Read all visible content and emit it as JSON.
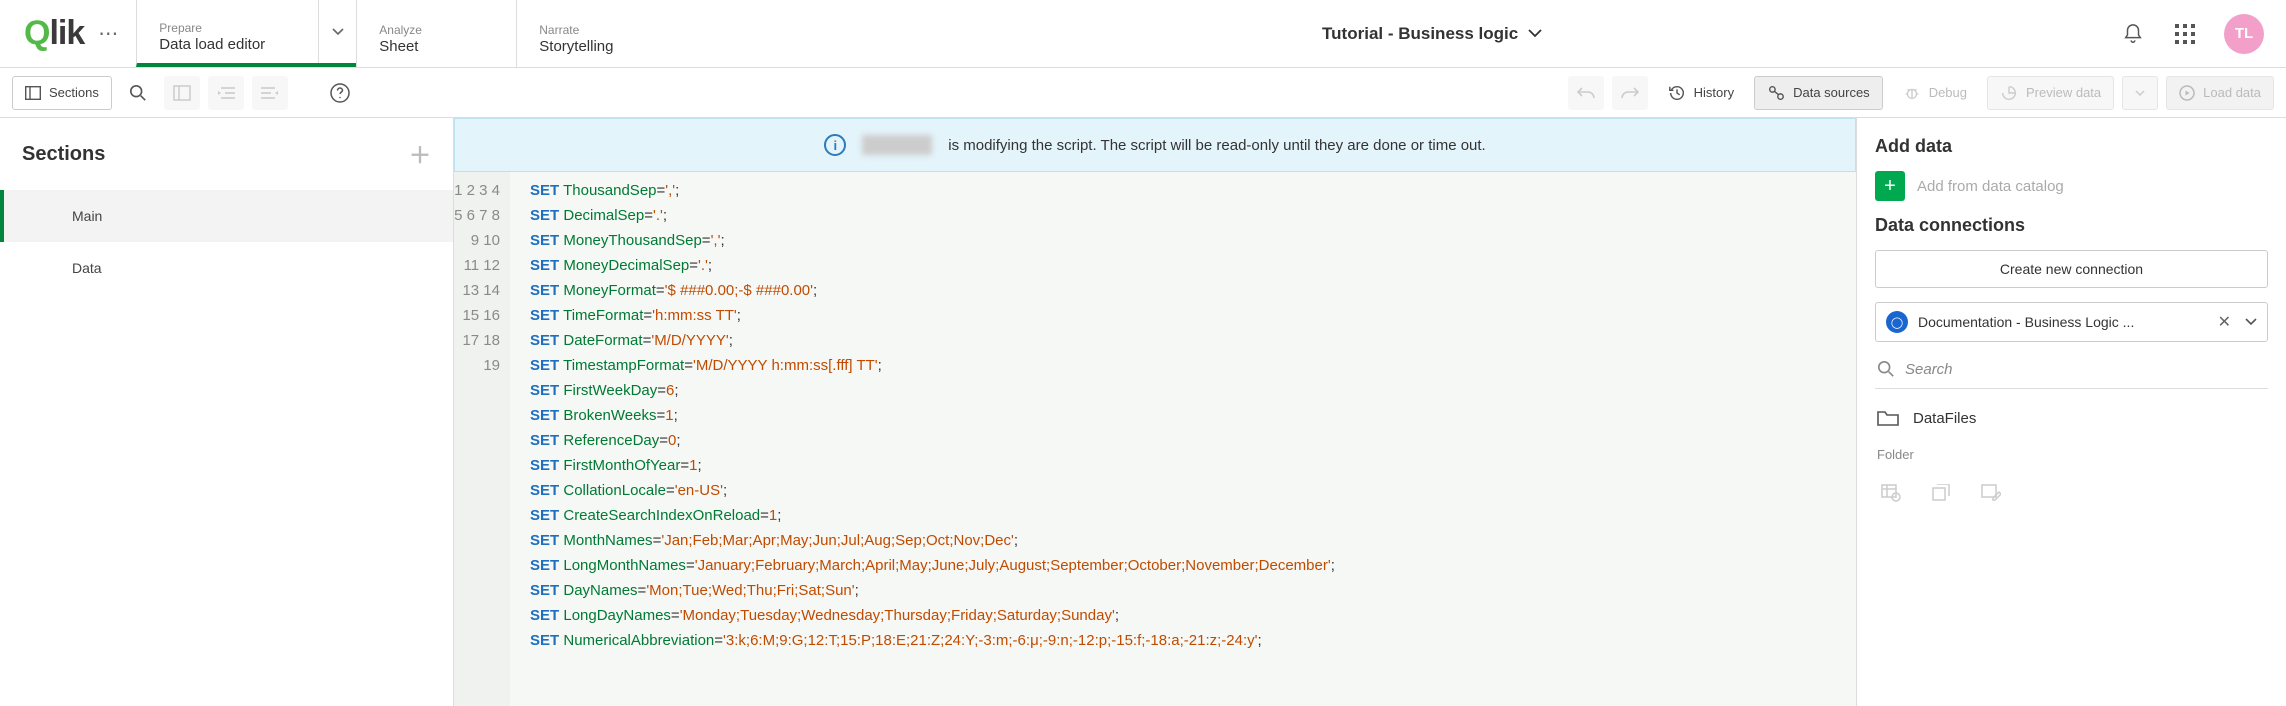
{
  "header": {
    "logo_text": "Qlik",
    "tabs": [
      {
        "small": "Prepare",
        "big": "Data load editor",
        "active": true,
        "has_chevron": true
      },
      {
        "small": "Analyze",
        "big": "Sheet",
        "active": false,
        "has_chevron": false
      },
      {
        "small": "Narrate",
        "big": "Storytelling",
        "active": false,
        "has_chevron": false
      }
    ],
    "app_title": "Tutorial - Business logic",
    "avatar_initials": "TL"
  },
  "toolbar": {
    "sections_label": "Sections",
    "history_label": "History",
    "data_sources_label": "Data sources",
    "debug_label": "Debug",
    "preview_label": "Preview data",
    "load_label": "Load data"
  },
  "sections_panel": {
    "title": "Sections",
    "items": [
      {
        "label": "Main",
        "active": true
      },
      {
        "label": "Data",
        "active": false
      }
    ]
  },
  "banner": {
    "message": "is modifying the script. The script will be read-only until they are done or time out."
  },
  "code": {
    "lines": [
      {
        "n": 1,
        "id": "ThousandSep",
        "rest": "=','",
        "tail": ";"
      },
      {
        "n": 2,
        "id": "DecimalSep",
        "rest": "='.'",
        "tail": ";"
      },
      {
        "n": 3,
        "id": "MoneyThousandSep",
        "rest": "=','",
        "tail": ";"
      },
      {
        "n": 4,
        "id": "MoneyDecimalSep",
        "rest": "='.'",
        "tail": ";"
      },
      {
        "n": 5,
        "id": "MoneyFormat",
        "rest": "='$ ###0.00;-$ ###0.00'",
        "tail": ";"
      },
      {
        "n": 6,
        "id": "TimeFormat",
        "rest": "='h:mm:ss TT'",
        "tail": ";"
      },
      {
        "n": 7,
        "id": "DateFormat",
        "rest": "='M/D/YYYY'",
        "tail": ";"
      },
      {
        "n": 8,
        "id": "TimestampFormat",
        "rest": "='M/D/YYYY h:mm:ss[.fff] TT'",
        "tail": ";"
      },
      {
        "n": 9,
        "id": "FirstWeekDay",
        "rest": "=6",
        "tail": ";"
      },
      {
        "n": 10,
        "id": "BrokenWeeks",
        "rest": "=1",
        "tail": ";"
      },
      {
        "n": 11,
        "id": "ReferenceDay",
        "rest": "=0",
        "tail": ";"
      },
      {
        "n": 12,
        "id": "FirstMonthOfYear",
        "rest": "=1",
        "tail": ";"
      },
      {
        "n": 13,
        "id": "CollationLocale",
        "rest": "='en-US'",
        "tail": ";"
      },
      {
        "n": 14,
        "id": "CreateSearchIndexOnReload",
        "rest": "=1",
        "tail": ";"
      },
      {
        "n": 15,
        "id": "MonthNames",
        "rest": "='Jan;Feb;Mar;Apr;May;Jun;Jul;Aug;Sep;Oct;Nov;Dec'",
        "tail": ";"
      },
      {
        "n": 16,
        "id": "LongMonthNames",
        "rest": "='January;February;March;April;May;June;July;August;September;October;November;December'",
        "tail": ";"
      },
      {
        "n": 17,
        "id": "DayNames",
        "rest": "='Mon;Tue;Wed;Thu;Fri;Sat;Sun'",
        "tail": ";"
      },
      {
        "n": 18,
        "id": "LongDayNames",
        "rest": "='Monday;Tuesday;Wednesday;Thursday;Friday;Saturday;Sunday'",
        "tail": ";"
      },
      {
        "n": 19,
        "id": "NumericalAbbreviation",
        "rest": "='3:k;6:M;9:G;12:T;15:P;18:E;21:Z;24:Y;-3:m;-6:μ;-9:n;-12:p;-15:f;-18:a;-21:z;-24:y'",
        "tail": ";"
      }
    ]
  },
  "right": {
    "add_data_title": "Add data",
    "add_catalog_label": "Add from data catalog",
    "connections_title": "Data connections",
    "create_conn_label": "Create new connection",
    "connection_name": "Documentation - Business Logic ...",
    "search_placeholder": "Search",
    "folder_item": "DataFiles",
    "folder_type": "Folder"
  }
}
